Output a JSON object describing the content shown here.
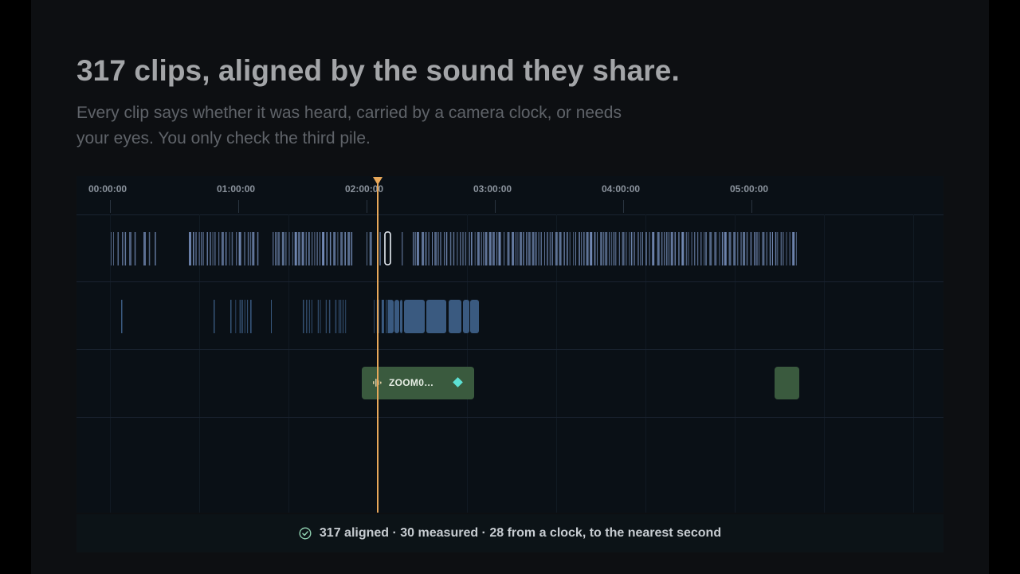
{
  "headline": "317 clips, aligned by the sound they share.",
  "subtitle": {
    "line1": "Every clip says whether it was heard, carried by a camera clock, or needs",
    "line2": "your eyes. You only check the third pile."
  },
  "timeline": {
    "ticks": [
      "00:00:00",
      "01:00:00",
      "02:00:00",
      "03:00:00",
      "04:00:00",
      "05:00:00"
    ],
    "playhead_time": "02:00:00",
    "clip_card": {
      "name": "ZOOM0…",
      "icons": [
        "waveform-icon",
        "keyframe-diamond-icon"
      ]
    }
  },
  "status": {
    "text": "317 aligned · 30 measured · 28 from a clock, to the nearest second",
    "icon": "check-circle-icon"
  },
  "colors": {
    "accent": "#e8a85a",
    "heard_clip": "#7f99c8",
    "clock_clip": "#3a5a80",
    "review_clip": "#3a5a3e",
    "marker": "#5de0d4"
  }
}
